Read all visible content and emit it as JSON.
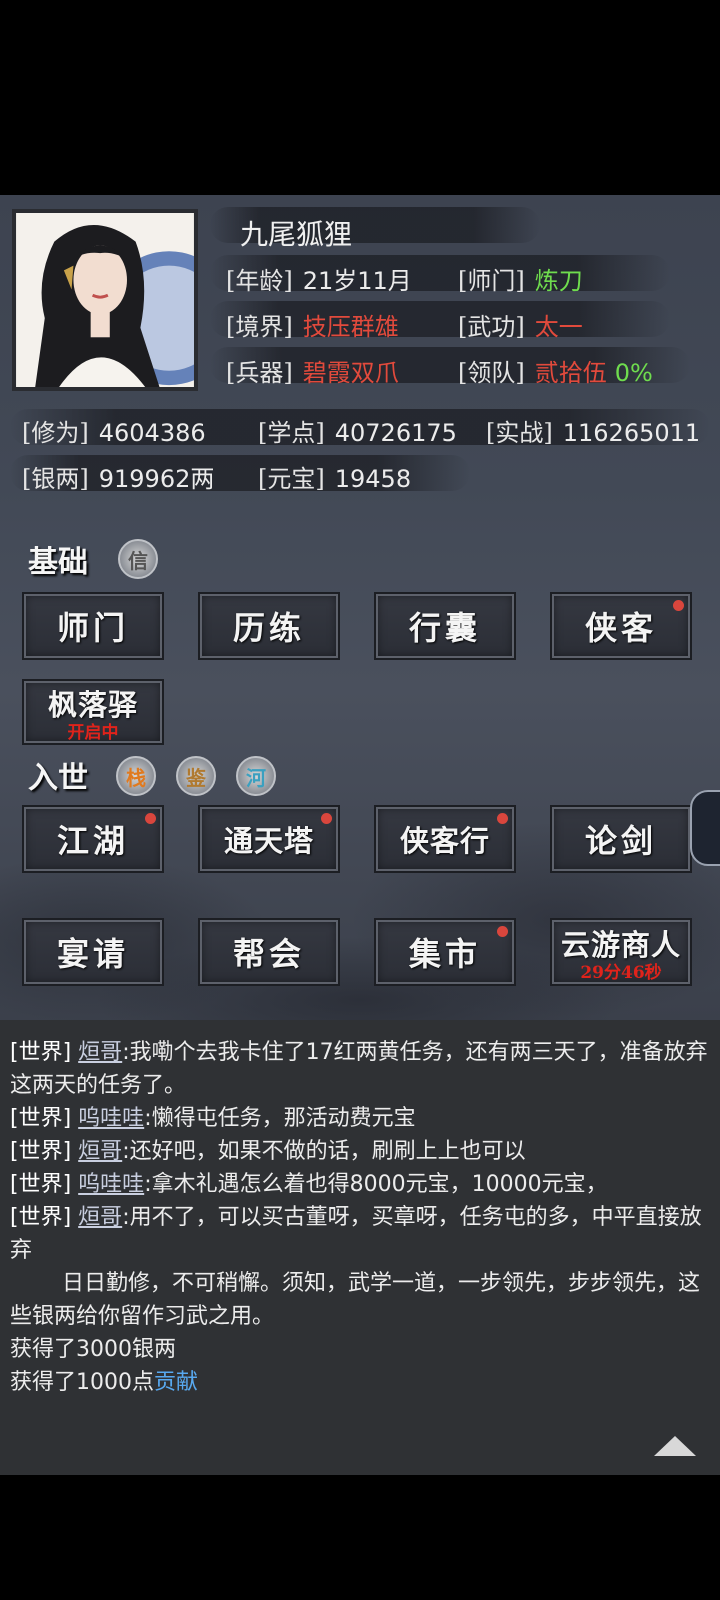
{
  "profile": {
    "name": "九尾狐狸",
    "age_label": "[年龄]",
    "age": "21岁11月",
    "sect_label": "[师门]",
    "sect": "炼刀",
    "realm_label": "[境界]",
    "realm": "技压群雄",
    "martial_label": "[武功]",
    "martial": "太一",
    "weapon_label": "[兵器]",
    "weapon": "碧霞双爪",
    "team_label": "[领队]",
    "team": "贰拾伍",
    "team_pct": "0%"
  },
  "stats": {
    "cultivation_label": "[修为]",
    "cultivation": "4604386",
    "study_label": "[学点]",
    "study": "40726175",
    "combat_label": "[实战]",
    "combat": "116265011",
    "silver_label": "[银两]",
    "silver": "919962两",
    "ingot_label": "[元宝]",
    "ingot": "19458"
  },
  "basic": {
    "title": "基础",
    "seal": "信",
    "buttons": [
      "师门",
      "历练",
      "行囊",
      "侠客"
    ],
    "fenglu": {
      "label": "枫落驿",
      "sub": "开启中"
    }
  },
  "world": {
    "title": "入世",
    "seals": [
      "栈",
      "鉴",
      "河"
    ],
    "row1": [
      "江湖",
      "通天塔",
      "侠客行",
      "论剑"
    ],
    "row2": [
      "宴请",
      "帮会",
      "集市"
    ],
    "merchant": {
      "label": "云游商人",
      "sub": "29分46秒"
    }
  },
  "chat": {
    "channel": "[世界]",
    "messages": [
      {
        "who": "烜哥",
        "text": ":我嘞个去我卡住了17红两黄任务，还有两三天了，准备放弃这两天的任务了。"
      },
      {
        "who": "呜哇哇",
        "text": ":懒得屯任务，那活动费元宝"
      },
      {
        "who": "烜哥",
        "text": ":还好吧，如果不做的话，刷刷上上也可以"
      },
      {
        "who": "呜哇哇",
        "text": ":拿木礼遇怎么着也得8000元宝，10000元宝，"
      },
      {
        "who": "烜哥",
        "text": ":用不了，可以买古董呀，买章呀，任务屯的多，中平直接放弃"
      }
    ],
    "system": "日日勤修，不可稍懈。须知，武学一道，一步领先，步步领先，这些银两给你留作习武之用。",
    "gain1": "获得了3000银两",
    "gain2_prefix": "获得了1000点",
    "gain2_link": "贡献"
  },
  "colors": {
    "red": "#e24a3c",
    "green": "#6fdc4e",
    "link": "#58a9f0",
    "badge": "#d9463d"
  }
}
